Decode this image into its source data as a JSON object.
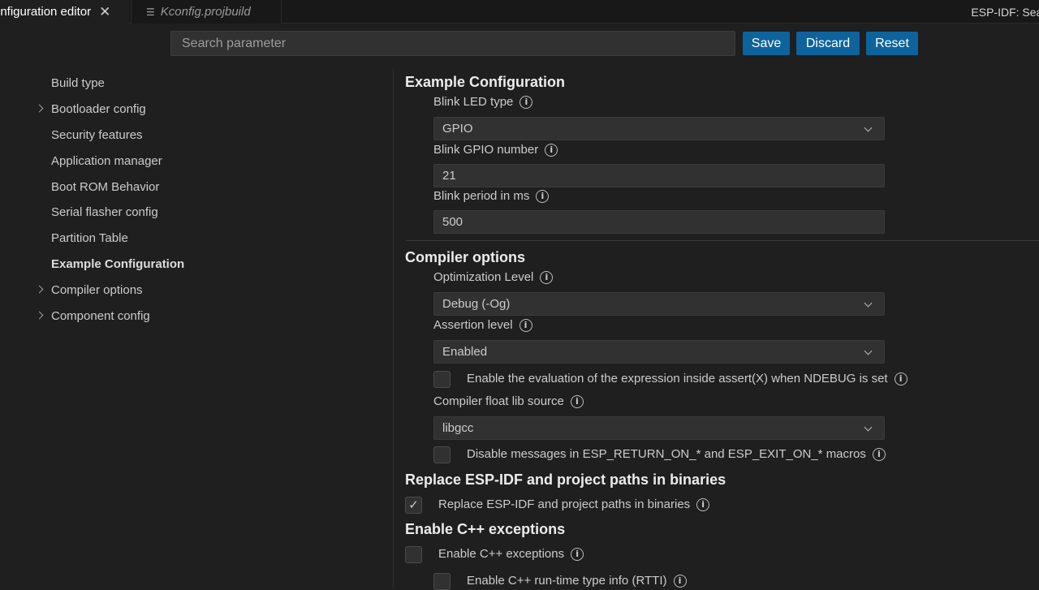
{
  "tabs": {
    "active_label": "onfiguration editor",
    "inactive_label": "Kconfig.projbuild",
    "right_label": "ESP-IDF: Searc"
  },
  "toolbar": {
    "search_placeholder": "Search parameter",
    "save_label": "Save",
    "discard_label": "Discard",
    "reset_label": "Reset"
  },
  "sidebar": {
    "items": [
      {
        "label": "Build type",
        "expandable": false
      },
      {
        "label": "Bootloader config",
        "expandable": true
      },
      {
        "label": "Security features",
        "expandable": false
      },
      {
        "label": "Application manager",
        "expandable": false
      },
      {
        "label": "Boot ROM Behavior",
        "expandable": false
      },
      {
        "label": "Serial flasher config",
        "expandable": false
      },
      {
        "label": "Partition Table",
        "expandable": false
      },
      {
        "label": "Example Configuration",
        "expandable": false,
        "active": true
      },
      {
        "label": "Compiler options",
        "expandable": true
      },
      {
        "label": "Component config",
        "expandable": true
      }
    ]
  },
  "main": {
    "example_config": {
      "title": "Example Configuration",
      "blink_led_type_label": "Blink LED type",
      "blink_led_type_value": "GPIO",
      "blink_gpio_label": "Blink GPIO number",
      "blink_gpio_value": "21",
      "blink_period_label": "Blink period in ms",
      "blink_period_value": "500"
    },
    "compiler_options": {
      "title": "Compiler options",
      "optimization_label": "Optimization Level",
      "optimization_value": "Debug (-Og)",
      "assertion_label": "Assertion level",
      "assertion_value": "Enabled",
      "assert_eval_label": "Enable the evaluation of the expression inside assert(X) when NDEBUG is set",
      "assert_eval_checked": false,
      "float_lib_label": "Compiler float lib source",
      "float_lib_value": "libgcc",
      "disable_msgs_label": "Disable messages in ESP_RETURN_ON_* and ESP_EXIT_ON_* macros",
      "disable_msgs_checked": false
    },
    "replace_paths": {
      "title": "Replace ESP-IDF and project paths in binaries",
      "checkbox_label": "Replace ESP-IDF and project paths in binaries",
      "checked": true
    },
    "cpp_exceptions": {
      "title": "Enable C++ exceptions",
      "checkbox_label": "Enable C++ exceptions",
      "checked": false,
      "rtti_label": "Enable C++ run-time type info (RTTI)",
      "rtti_checked": false
    }
  },
  "colors": {
    "background": "#1f1f1f",
    "button": "#0e639c",
    "field": "#313131"
  }
}
